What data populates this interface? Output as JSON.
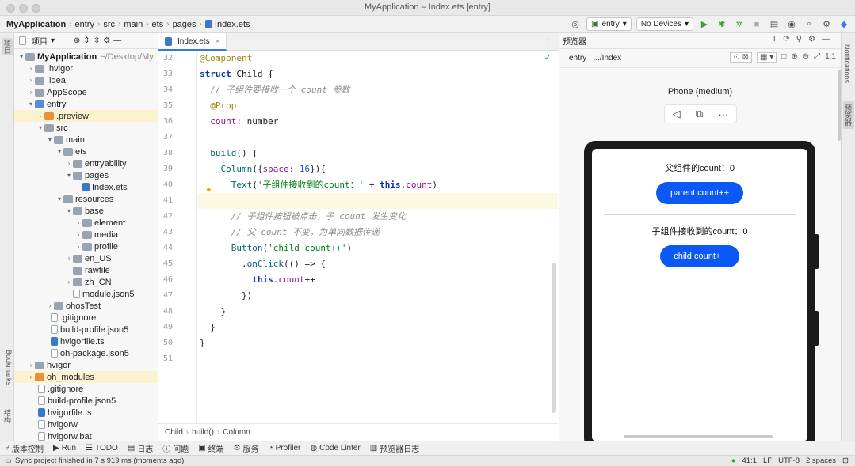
{
  "window": {
    "title": "MyApplication – Index.ets [entry]"
  },
  "navbar": {
    "crumbs": [
      "MyApplication",
      "entry",
      "src",
      "main",
      "ets",
      "pages",
      "Index.ets"
    ],
    "config": "entry",
    "device": "No Devices"
  },
  "left_strip": {
    "project": "项目",
    "bookmarks": "Bookmarks",
    "structure": "结构"
  },
  "project": {
    "header": "项目",
    "items": [
      {
        "label": "MyApplication",
        "dim": "~/Desktop/My"
      },
      {
        "label": ".hvigor"
      },
      {
        "label": ".idea"
      },
      {
        "label": "AppScope"
      },
      {
        "label": "entry"
      },
      {
        "label": ".preview"
      },
      {
        "label": "src"
      },
      {
        "label": "main"
      },
      {
        "label": "ets"
      },
      {
        "label": "entryability"
      },
      {
        "label": "pages"
      },
      {
        "label": "Index.ets"
      },
      {
        "label": "resources"
      },
      {
        "label": "base"
      },
      {
        "label": "element"
      },
      {
        "label": "media"
      },
      {
        "label": "profile"
      },
      {
        "label": "en_US"
      },
      {
        "label": "rawfile"
      },
      {
        "label": "zh_CN"
      },
      {
        "label": "module.json5"
      },
      {
        "label": "ohosTest"
      },
      {
        "label": ".gitignore"
      },
      {
        "label": "build-profile.json5"
      },
      {
        "label": "hvigorfile.ts"
      },
      {
        "label": "oh-package.json5"
      },
      {
        "label": "hvigor"
      },
      {
        "label": "oh_modules"
      },
      {
        "label": ".gitignore"
      },
      {
        "label": "build-profile.json5"
      },
      {
        "label": "hvigorfile.ts"
      },
      {
        "label": "hvigorw"
      },
      {
        "label": "hvigorw.bat"
      }
    ]
  },
  "editor": {
    "tab": "Index.ets",
    "line_numbers": [
      "32",
      "33",
      "34",
      "35",
      "36",
      "37",
      "38",
      "39",
      "40",
      "41",
      "42",
      "43",
      "44",
      "45",
      "46",
      "47",
      "48",
      "49",
      "50",
      "51"
    ],
    "breadcrumbs": [
      "Child",
      "build()",
      "Column"
    ]
  },
  "preview": {
    "header": "预览器",
    "path": "entry : .../Index",
    "device": "Phone (medium)",
    "parent_text": "父组件的count：0",
    "parent_button": "parent count++",
    "child_text": "子组件接收到的count：0",
    "child_button": "child count++"
  },
  "right_strip": {
    "notifications": "Notifications",
    "previewer": "预览器"
  },
  "toolwindows": [
    "版本控制",
    "Run",
    "TODO",
    "日志",
    "问题",
    "终端",
    "服务",
    "Profiler",
    "Code Linter",
    "预览器日志"
  ],
  "status": {
    "message": "Sync project finished in 7 s 919 ms (moments ago)",
    "position": "41:1",
    "line_sep": "LF",
    "encoding": "UTF-8",
    "indent": "2 spaces"
  },
  "colors": {
    "accent": "#3574f0",
    "button": "#0a59f7"
  }
}
